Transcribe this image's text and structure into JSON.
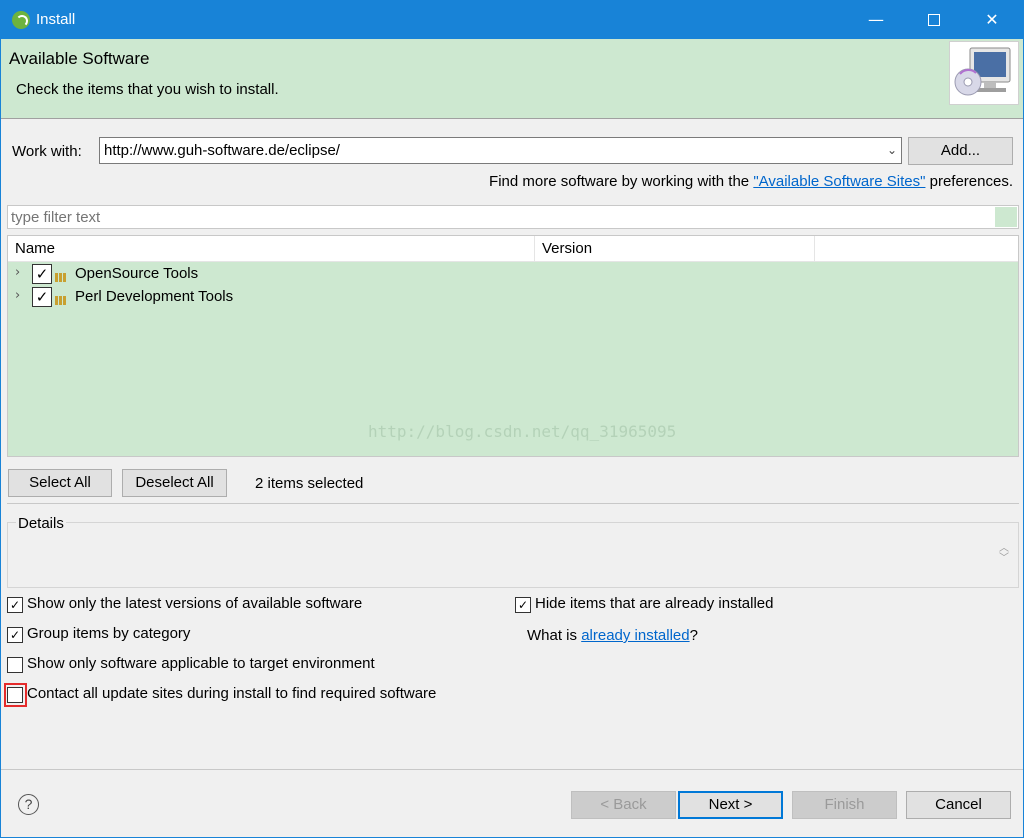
{
  "window": {
    "title": "Install",
    "minimize": "—",
    "close": "✕"
  },
  "header": {
    "title": "Available Software",
    "description": "Check the items that you wish to install."
  },
  "work_with": {
    "label": "Work with:",
    "value": "http://www.guh-software.de/eclipse/",
    "add_button": "Add...",
    "hint_prefix": "Find more software by working with the ",
    "hint_link": "\"Available Software Sites\"",
    "hint_suffix": " preferences."
  },
  "filter": {
    "placeholder": "type filter text"
  },
  "tree": {
    "columns": [
      "Name",
      "Version"
    ],
    "items": [
      {
        "label": "OpenSource Tools",
        "checked": true
      },
      {
        "label": "Perl Development Tools",
        "checked": true
      }
    ],
    "watermark": "http://blog.csdn.net/qq_31965095"
  },
  "selection": {
    "select_all": "Select All",
    "deselect_all": "Deselect All",
    "status": "2 items selected"
  },
  "details": {
    "label": "Details"
  },
  "options": {
    "latest_versions": {
      "label": "Show only the latest versions of available software",
      "checked": true
    },
    "group_by_category": {
      "label": "Group items by category",
      "checked": true
    },
    "target_env": {
      "label": "Show only software applicable to target environment",
      "checked": false
    },
    "contact_sites": {
      "label": "Contact all update sites during install to find required software",
      "checked": false
    },
    "hide_installed": {
      "label": "Hide items that are already installed",
      "checked": true
    },
    "what_is_prefix": "What is ",
    "what_is_link": "already installed",
    "what_is_suffix": "?"
  },
  "footer": {
    "help": "?",
    "back": "< Back",
    "next": "Next >",
    "finish": "Finish",
    "cancel": "Cancel"
  },
  "colors": {
    "titlebar": "#1883d7",
    "header_bg": "#cde8d0",
    "highlight": "#e52b2b"
  }
}
